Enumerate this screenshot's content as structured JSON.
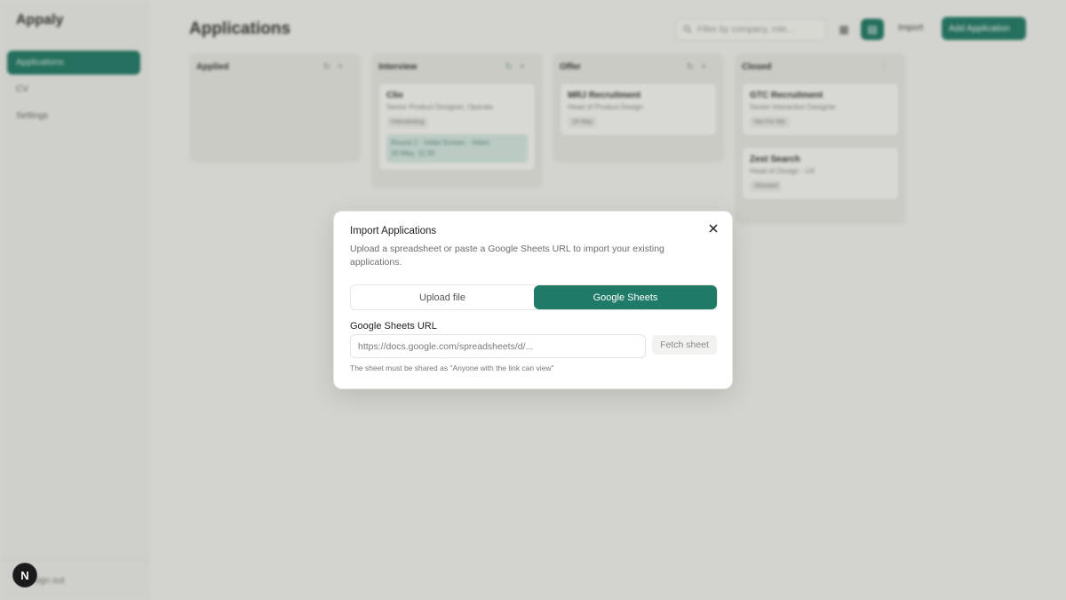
{
  "sidebar": {
    "brand": "Appaly",
    "items": [
      {
        "label": "Applications",
        "active": true
      },
      {
        "label": "CV",
        "active": false
      },
      {
        "label": "Settings",
        "active": false
      }
    ],
    "sign_out": "Sign out"
  },
  "header": {
    "title": "Applications",
    "filter_placeholder": "Filter by company, role...",
    "import_label": "Import",
    "add_label": "Add Application"
  },
  "board": {
    "columns": [
      {
        "title": "Applied",
        "cards": []
      },
      {
        "title": "Interview",
        "cards": [
          {
            "company": "Clio",
            "role": "Senior Product Designer, Operate",
            "tag": "Interviewing",
            "event": "Round 1 - Initial Screen - Video",
            "event_time": "20 May, 11:30"
          }
        ]
      },
      {
        "title": "Offer",
        "cards": [
          {
            "company": "MRJ Recruitment",
            "role": "Head of Product Design",
            "tag": "18 May"
          }
        ]
      },
      {
        "title": "Closed",
        "cards": [
          {
            "company": "GTC Recruitment",
            "role": "Senior Interaction Designer",
            "tag": "Not For Me"
          },
          {
            "company": "Zest Search",
            "role": "Head of Design - UX",
            "tag": "Ghosted"
          }
        ]
      }
    ]
  },
  "modal": {
    "title": "Import Applications",
    "description": "Upload a spreadsheet or paste a Google Sheets URL to import your existing applications.",
    "tabs": [
      {
        "label": "Upload file",
        "active": false
      },
      {
        "label": "Google Sheets",
        "active": true
      }
    ],
    "url_label": "Google Sheets URL",
    "url_value": "",
    "url_placeholder": "https://docs.google.com/spreadsheets/d/...",
    "fetch_label": "Fetch sheet",
    "hint": "The sheet must be shared as \"Anyone with the link can view\""
  },
  "dev_badge": "N",
  "colors": {
    "accent": "#1f7a68",
    "background": "#f5f5f3",
    "overlay": "rgba(60,60,45,0.18)"
  },
  "icons": [
    "close-icon",
    "search-icon",
    "grid-icon",
    "list-icon",
    "refresh-icon",
    "plus-icon",
    "more-icon"
  ]
}
